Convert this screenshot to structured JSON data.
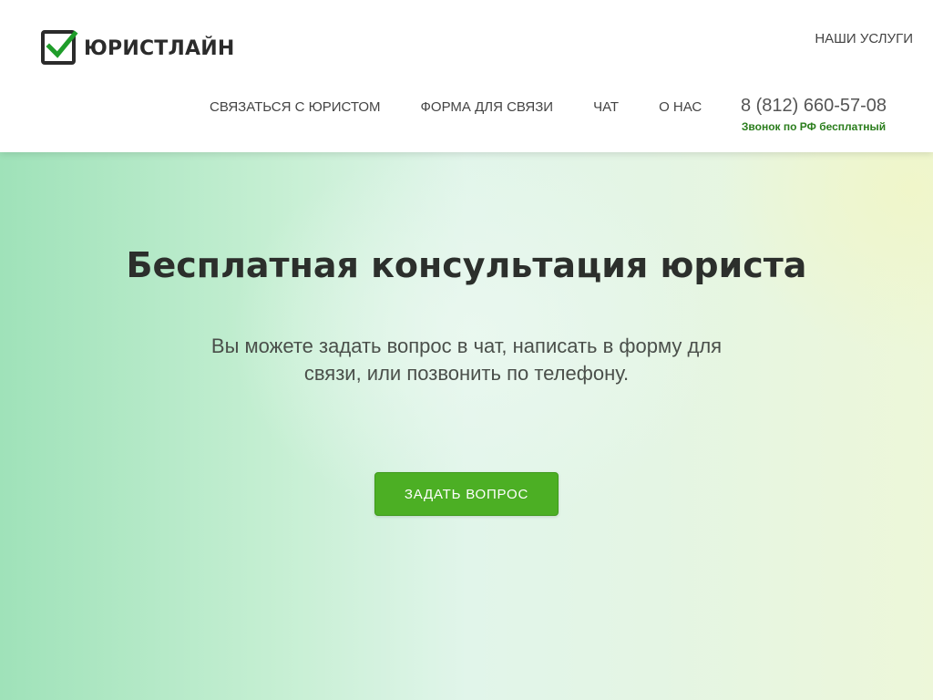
{
  "colors": {
    "accent_green": "#4caf24",
    "logo_check": "#1f9d2a",
    "phone_note_green": "#2a7d1c",
    "title_dark": "#2c2f2c"
  },
  "header": {
    "logo_icon": "checkbox-checked-icon",
    "logo_text": "ЮРИСТЛАЙН",
    "top_link": "НАШИ УСЛУГИ",
    "nav": [
      {
        "label": "СВЯЗАТЬСЯ С ЮРИСТОМ"
      },
      {
        "label": "ФОРМА ДЛЯ СВЯЗИ"
      },
      {
        "label": "ЧАТ"
      },
      {
        "label": "О НАС"
      }
    ],
    "phone": "8 (812) 660-57-08",
    "phone_note": "Звонок по РФ бесплатный"
  },
  "hero": {
    "title": "Бесплатная консультация юриста",
    "subtitle": "Вы можете задать вопрос в чат, написать в форму для связи, или позвонить по телефону.",
    "cta_label": "ЗАДАТЬ ВОПРОС"
  }
}
